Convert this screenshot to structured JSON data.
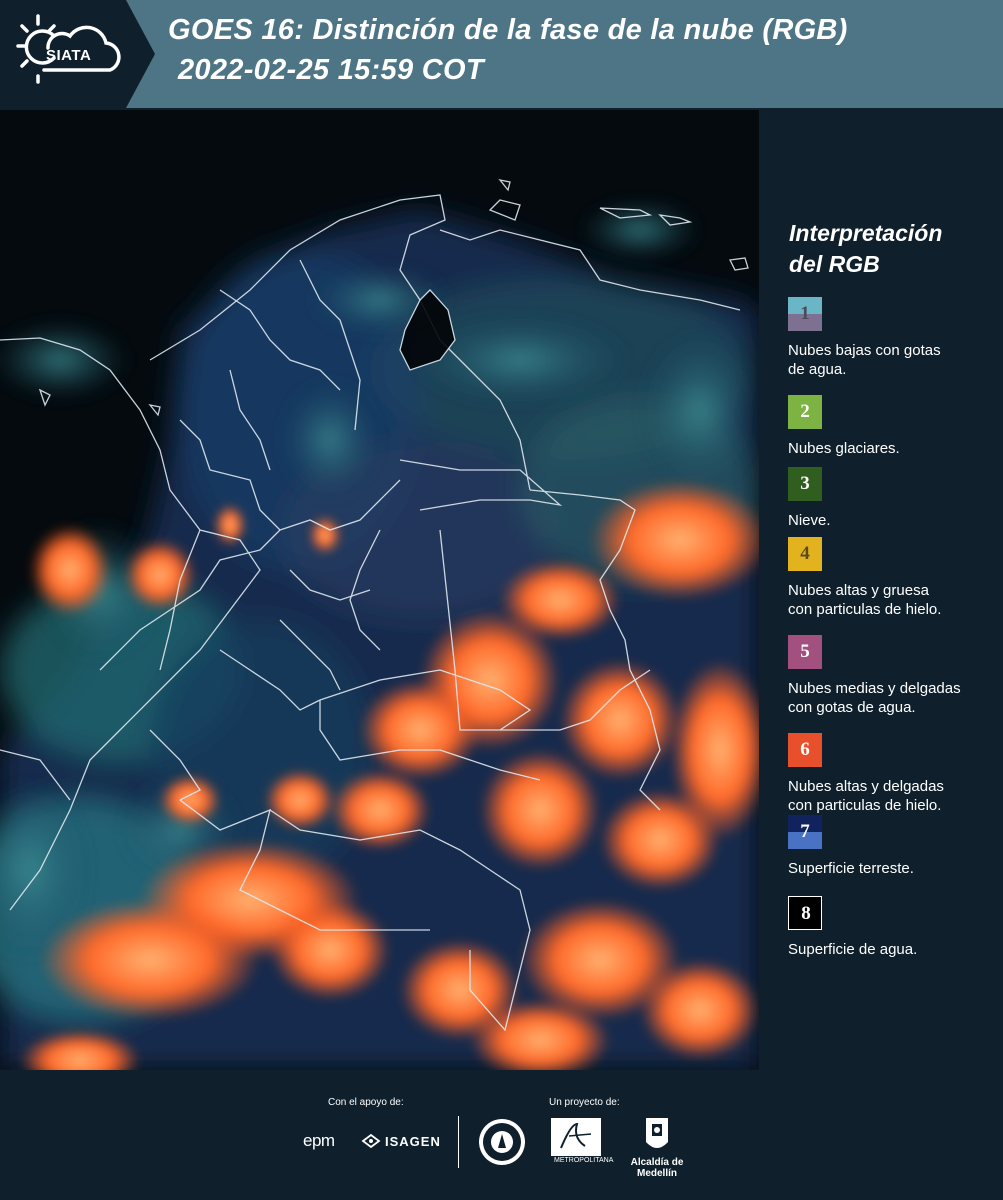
{
  "header": {
    "logo_text": "SIATA",
    "title_line1": "GOES 16: Distinción de la fase de la nube (RGB)",
    "title_line2": "2022-02-25 15:59 COT"
  },
  "legend": {
    "title_line1": "Interpretación",
    "title_line2": "del RGB",
    "items": [
      {
        "number": "1",
        "label_line1": "Nubes bajas con gotas",
        "label_line2": "de agua.",
        "color_top": "#6ab6c7",
        "color_bottom": "#7e7090",
        "text_color": "#4a4a5a"
      },
      {
        "number": "2",
        "label_line1": "Nubes glaciares.",
        "label_line2": "",
        "color_top": "#7cb342",
        "color_bottom": "#7cb342",
        "text_color": "#ffffff"
      },
      {
        "number": "3",
        "label_line1": "Nieve.",
        "label_line2": "",
        "color_top": "#2f5e1e",
        "color_bottom": "#2f5e1e",
        "text_color": "#ffffff"
      },
      {
        "number": "4",
        "label_line1": "Nubes altas y gruesa",
        "label_line2": "con particulas de hielo.",
        "color_top": "#e3b21f",
        "color_bottom": "#e3b21f",
        "text_color": "#5a4a20"
      },
      {
        "number": "5",
        "label_line1": "Nubes medias y delgadas",
        "label_line2": "con gotas de agua.",
        "color_top": "#a2507f",
        "color_bottom": "#a2507f",
        "text_color": "#ffffff"
      },
      {
        "number": "6",
        "label_line1": "Nubes altas y delgadas",
        "label_line2": "con particulas de hielo.",
        "color_top": "#e8502c",
        "color_bottom": "#e8502c",
        "text_color": "#ffffff"
      },
      {
        "number": "7",
        "label_line1": "Superficie terreste.",
        "label_line2": "",
        "color_top": "#11235f",
        "color_bottom": "#4a72c4",
        "text_color": "#ffffff"
      },
      {
        "number": "8",
        "label_line1": "Superficie de agua.",
        "label_line2": "",
        "color_top": "#000000",
        "color_bottom": "#000000",
        "text_color": "#ffffff"
      }
    ]
  },
  "footer": {
    "support_label": "Con el apoyo de:",
    "project_label": "Un proyecto de:",
    "sponsor1": "epm",
    "sponsor2": "ISAGEN",
    "partner_area": "METROPOLITANA",
    "partner_alcaldia": "Alcaldía de Medellín"
  }
}
